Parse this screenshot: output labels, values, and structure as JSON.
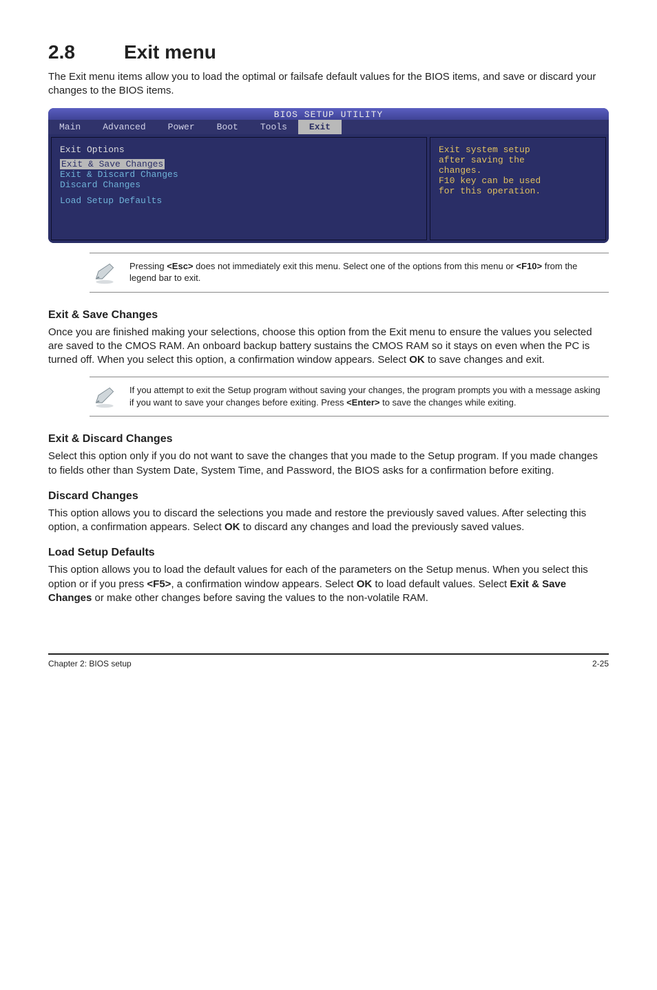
{
  "header": {
    "section_number": "2.8",
    "section_title": "Exit menu",
    "intro": "The Exit menu items allow you to load the optimal or failsafe default values for the BIOS items, and save or discard your changes to the BIOS items."
  },
  "bios": {
    "title": "BIOS SETUP UTILITY",
    "tabs": [
      "Main",
      "Advanced",
      "Power",
      "Boot",
      "Tools",
      "Exit"
    ],
    "active_tab": "Exit",
    "left_heading": "Exit Options",
    "items": [
      "Exit & Save Changes",
      "Exit & Discard Changes",
      "Discard Changes",
      "Load Setup Defaults"
    ],
    "highlighted_item": "Exit & Save Changes",
    "help_lines": [
      "Exit system setup",
      "after saving the",
      "changes.",
      "",
      "F10 key can be used",
      "for this operation."
    ]
  },
  "note1": {
    "text_parts": [
      "Pressing ",
      "<Esc>",
      " does not immediately exit this menu. Select one of the options from this menu or ",
      "<F10>",
      " from the legend bar to exit."
    ]
  },
  "sections": {
    "s1": {
      "title": "Exit & Save Changes",
      "body": "Once you are finished making your selections, choose this option from the Exit menu to ensure the values you selected are saved to the CMOS RAM. An onboard backup battery sustains the CMOS RAM so it stays on even when the PC is turned off. When you select this option, a confirmation window appears. Select OK to save changes and exit.",
      "bold_inline": "OK"
    },
    "note2": {
      "text_parts": [
        " If you attempt to exit the Setup program without saving your changes, the program prompts you with a message asking if you want to save your changes before exiting. Press ",
        "<Enter>",
        " to save the  changes while exiting."
      ]
    },
    "s2": {
      "title": "Exit & Discard Changes",
      "body": "Select this option only if you do not want to save the changes that you  made to the Setup program. If you made changes to fields other than System Date, System Time, and Password, the BIOS asks for a confirmation before exiting."
    },
    "s3": {
      "title": "Discard Changes",
      "body_parts": [
        "This option allows you to discard the selections you made and restore the previously saved values. After selecting this option, a confirmation appears. Select ",
        "OK",
        " to discard any changes and load the previously saved values."
      ]
    },
    "s4": {
      "title": "Load Setup Defaults",
      "body_parts": [
        "This option allows you to load the default values for each of the parameters on the Setup menus. When you select this option or if you press ",
        "<F5>",
        ", a confirmation window appears. Select ",
        "OK",
        " to load default values. Select ",
        "Exit & Save Changes",
        " or make other changes before saving the values to the non-volatile RAM."
      ]
    }
  },
  "footer": {
    "left": "Chapter 2: BIOS setup",
    "right": "2-25"
  }
}
